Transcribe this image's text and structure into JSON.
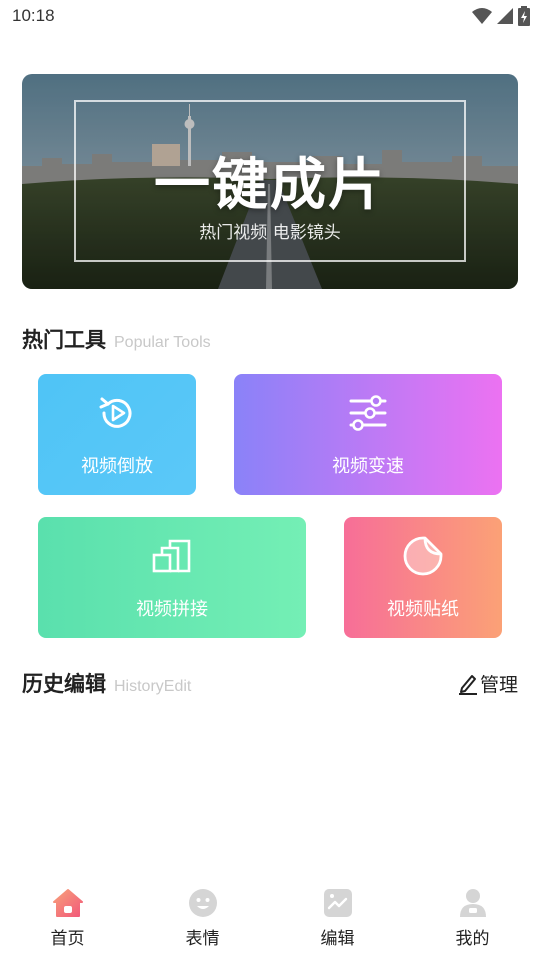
{
  "status_bar": {
    "time": "10:18"
  },
  "banner": {
    "title": "一键成片",
    "subtitle": "热门视频 电影镜头"
  },
  "tools_section": {
    "title": "热门工具",
    "subtitle": "Popular Tools"
  },
  "tools": [
    {
      "label": "视频倒放",
      "icon": "replay-icon"
    },
    {
      "label": "视频变速",
      "icon": "sliders-icon"
    },
    {
      "label": "视频拼接",
      "icon": "layers-icon"
    },
    {
      "label": "视频贴纸",
      "icon": "sticker-icon"
    }
  ],
  "history_section": {
    "title": "历史编辑",
    "subtitle": "HistoryEdit",
    "manage_label": "管理"
  },
  "bottom_nav": {
    "items": [
      {
        "label": "首页",
        "icon": "home-icon",
        "active": true
      },
      {
        "label": "表情",
        "icon": "smiley-icon",
        "active": false
      },
      {
        "label": "编辑",
        "icon": "image-edit-icon",
        "active": false
      },
      {
        "label": "我的",
        "icon": "person-icon",
        "active": false
      }
    ]
  },
  "colors": {
    "active_tab": "#f57070",
    "inactive_tab": "#d5d5d5",
    "accent_blue": "#4fc4f6",
    "accent_purple": "#ec72f2",
    "accent_green": "#5ae0ad",
    "accent_pink": "#f76e98"
  }
}
